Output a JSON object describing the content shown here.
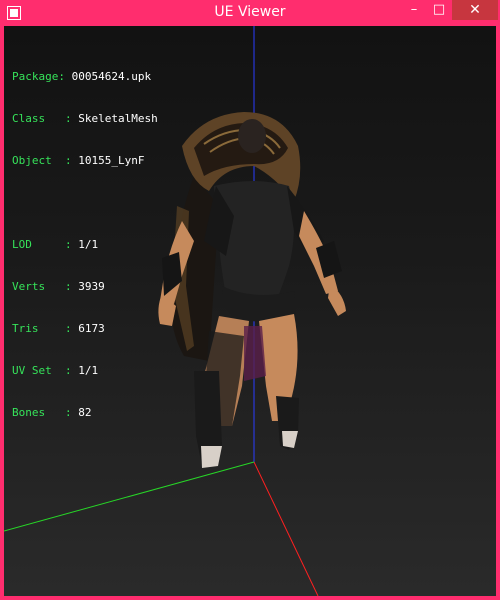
{
  "window": {
    "title": "UE Viewer",
    "controls": {
      "minimize": "–",
      "maximize": "□",
      "close": "✕"
    },
    "frame_color": "#ff2d6e",
    "close_color": "#c7363f"
  },
  "info": {
    "rows_a": [
      {
        "label": "Package: ",
        "value": "00054624.upk"
      },
      {
        "label": "Class   : ",
        "value": "SkeletalMesh"
      },
      {
        "label": "Object  : ",
        "value": "10155_LynF"
      }
    ],
    "rows_b": [
      {
        "label": "LOD     : ",
        "value": "1/1"
      },
      {
        "label": "Verts   : ",
        "value": "3939"
      },
      {
        "label": "Tris    : ",
        "value": "6173"
      },
      {
        "label": "UV Set  : ",
        "value": "1/1"
      },
      {
        "label": "Bones   : ",
        "value": "82"
      }
    ],
    "label_color": "#36e35a",
    "value_color": "#ffffff"
  },
  "axes": {
    "x_color": "#ff2020",
    "y_color": "#2a3cff",
    "z_color": "#27d627"
  },
  "icons": {
    "app": "app-window-icon",
    "model": "character-mesh"
  }
}
